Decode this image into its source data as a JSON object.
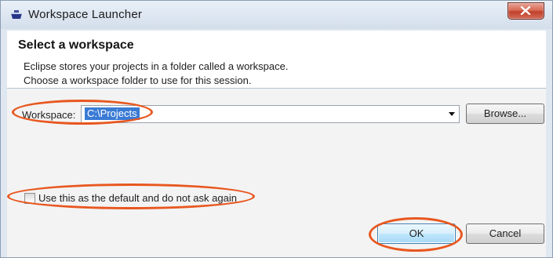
{
  "window": {
    "title": "Workspace Launcher",
    "close_label": "x"
  },
  "header": {
    "heading": "Select a workspace",
    "description_line1": "Eclipse stores your projects in a folder called a workspace.",
    "description_line2": "Choose a workspace folder to use for this session."
  },
  "workspace": {
    "label": "Workspace:",
    "value": "C:\\Projects",
    "browse_label": "Browse..."
  },
  "default_option": {
    "label": "Use this as the default and do not ask again",
    "checked": false
  },
  "buttons": {
    "ok_label": "OK",
    "cancel_label": "Cancel"
  },
  "colors": {
    "annotation": "#e8571f",
    "selection": "#3a7bd5"
  }
}
